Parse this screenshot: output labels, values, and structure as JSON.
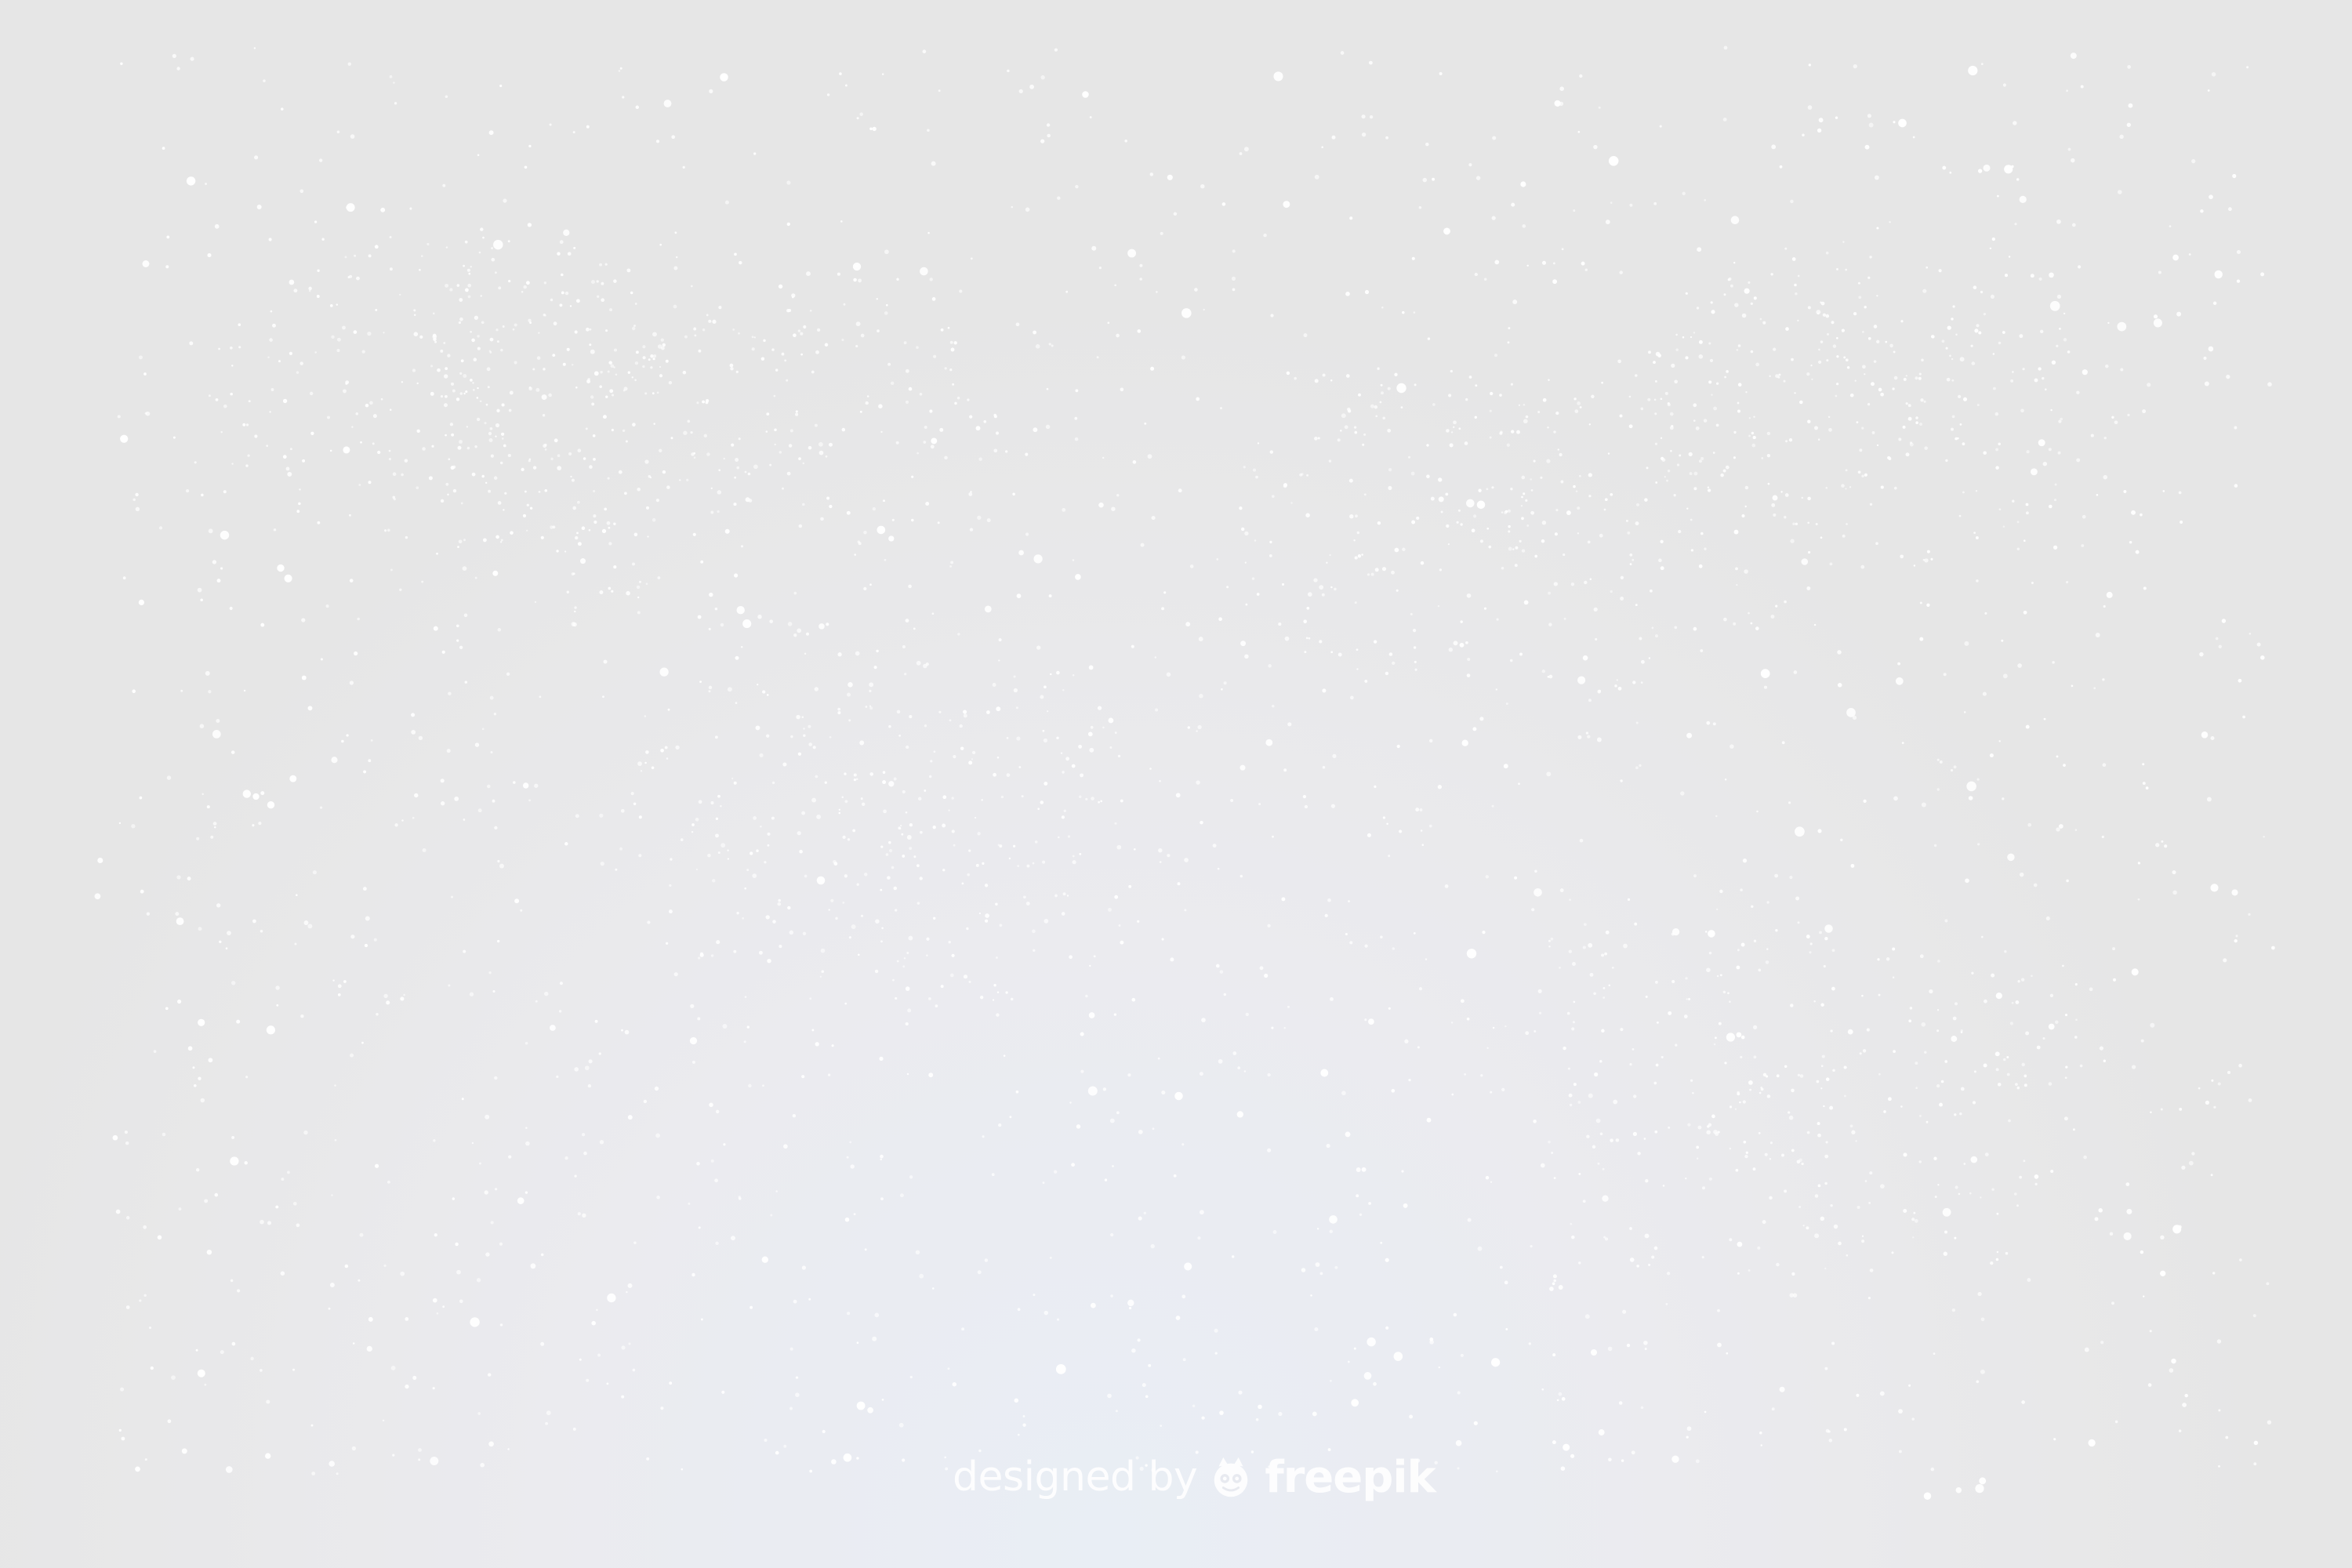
{
  "watermark": {
    "prefix": "designed by",
    "brand": "freepik",
    "logo_icon": "freepik-logo-icon"
  },
  "palette": {
    "background_outer": "#e6e6e6",
    "background_inner": "#e9eef5",
    "snow": "#ffffff"
  }
}
